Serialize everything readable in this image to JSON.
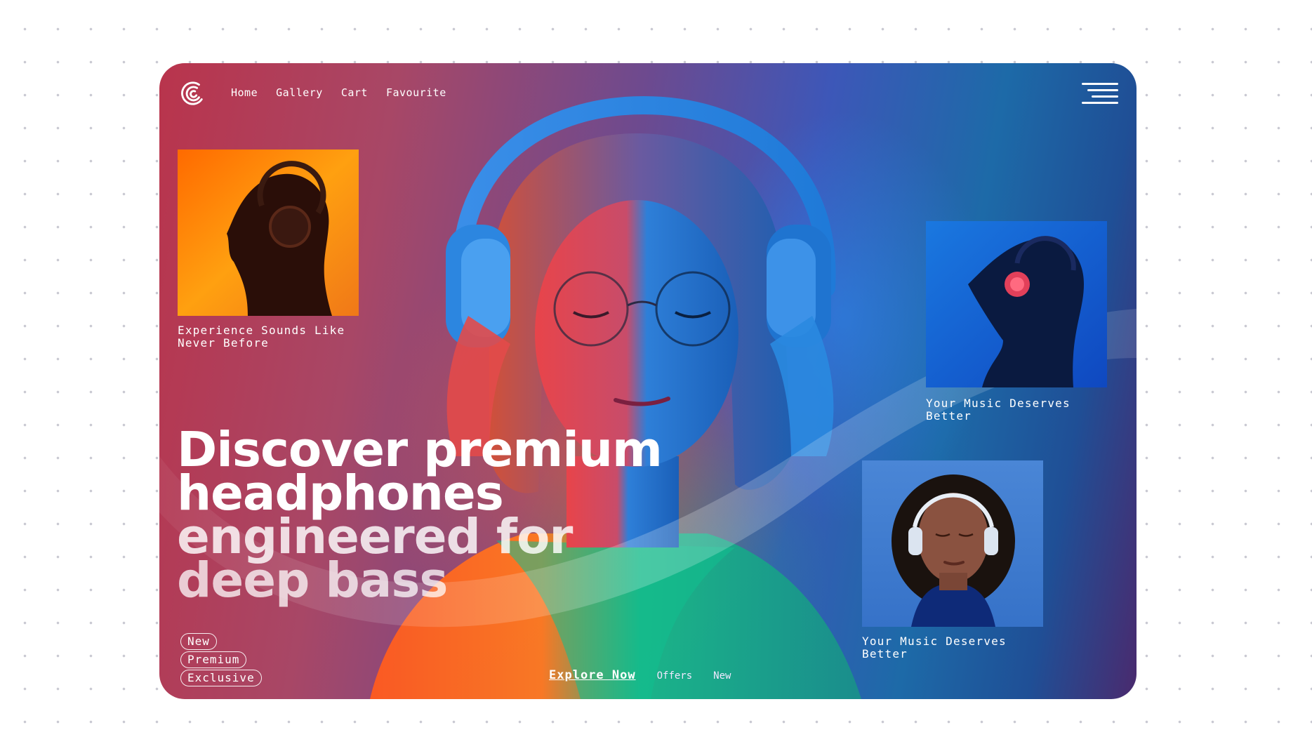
{
  "nav": {
    "items": [
      {
        "label": "Home"
      },
      {
        "label": "Gallery"
      },
      {
        "label": "Cart"
      },
      {
        "label": "Favourite"
      }
    ]
  },
  "cards": [
    {
      "caption": "Experience Sounds Like Never Before"
    },
    {
      "caption": "Your Music Deserves Better"
    },
    {
      "caption": "Your Music Deserves Better"
    }
  ],
  "hero": {
    "headline_lines": [
      "Discover premium",
      "headphones",
      "engineered for",
      "deep bass"
    ]
  },
  "tags": [
    "New",
    "Premium",
    "Exclusive"
  ],
  "bottom_links": {
    "explore": "Explore Now",
    "offers": "Offers",
    "new": "New"
  },
  "colors": {
    "accent_red": "#e23a3a",
    "accent_blue": "#1f6fd6",
    "text": "#ffffff"
  },
  "icons": {
    "logo": "sound-wave-logo-icon",
    "menu": "hamburger-menu-icon"
  }
}
